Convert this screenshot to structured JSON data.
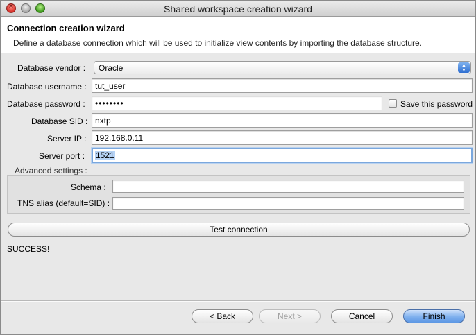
{
  "window": {
    "title": "Shared workspace creation wizard"
  },
  "header": {
    "title": "Connection creation wizard",
    "description": "Define a database connection which will be used to initialize view contents by importing the database structure."
  },
  "form": {
    "vendor_label": "Database vendor :",
    "vendor_value": "Oracle",
    "username_label": "Database username :",
    "username_value": "tut_user",
    "password_label": "Database password :",
    "password_value": "••••••••",
    "save_password_label": "Save this password",
    "save_password_checked": false,
    "sid_label": "Database SID :",
    "sid_value": "nxtp",
    "ip_label": "Server IP :",
    "ip_value": "192.168.0.11",
    "port_label": "Server port :",
    "port_value": "1521"
  },
  "advanced": {
    "label": "Advanced settings :",
    "schema_label": "Schema :",
    "schema_value": "",
    "tns_label": "TNS alias (default=SID) :",
    "tns_value": ""
  },
  "test_button": "Test connection",
  "status_text": "SUCCESS!",
  "footer": {
    "back": "< Back",
    "next": "Next >",
    "cancel": "Cancel",
    "finish": "Finish"
  },
  "colors": {
    "accent": "#5d97e4",
    "focus_ring": "#7aa7dd"
  }
}
